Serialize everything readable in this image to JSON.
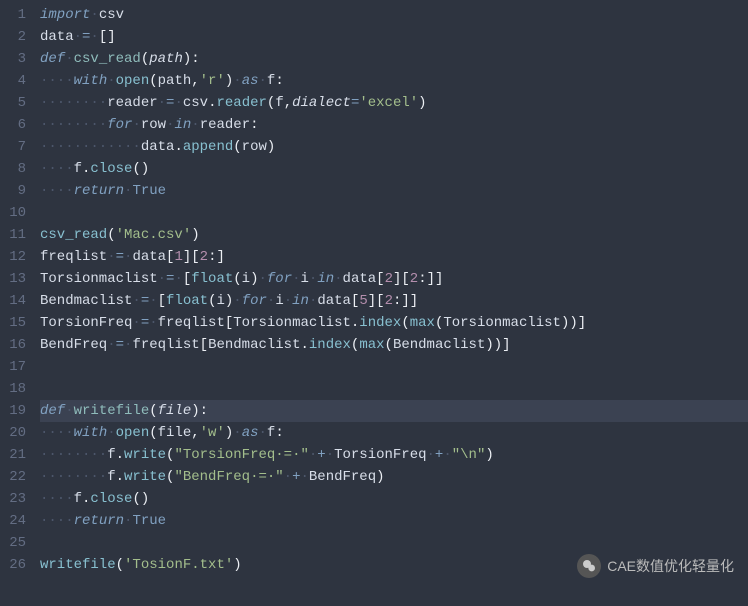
{
  "line_count": 26,
  "highlighted_line": 19,
  "watermark": {
    "text": "CAE数值优化轻量化"
  },
  "tokens": {
    "import": "import",
    "def": "def",
    "with": "with",
    "as": "as",
    "for": "for",
    "in": "in",
    "return": "return",
    "True": "True",
    "csv": "csv",
    "data": "data",
    "csv_read": "csv_read",
    "path": "path",
    "open": "open",
    "f": "f",
    "reader": "reader",
    "row": "row",
    "append": "append",
    "close": "close",
    "freqlist": "freqlist",
    "Torsionmaclist": "Torsionmaclist",
    "Bendmaclist": "Bendmaclist",
    "TorsionFreq": "TorsionFreq",
    "BendFreq": "BendFreq",
    "float": "float",
    "i": "i",
    "index": "index",
    "max": "max",
    "writefile": "writefile",
    "file": "file",
    "write": "write",
    "dialect": "dialect",
    "r_str": "'r'",
    "w_str": "'w'",
    "excel_str": "'excel'",
    "mac_csv": "'Mac.csv'",
    "tosion_txt": "'TosionF.txt'",
    "torsion_str": "\"TorsionFreq·=·\"",
    "bend_str": "\"BendFreq·=·\"",
    "newline_str": "\"\\n\"",
    "n1": "1",
    "n2": "2",
    "n5": "5"
  },
  "line_numbers": [
    "1",
    "2",
    "3",
    "4",
    "5",
    "6",
    "7",
    "8",
    "9",
    "10",
    "11",
    "12",
    "13",
    "14",
    "15",
    "16",
    "17",
    "18",
    "19",
    "20",
    "21",
    "22",
    "23",
    "24",
    "25",
    "26"
  ]
}
